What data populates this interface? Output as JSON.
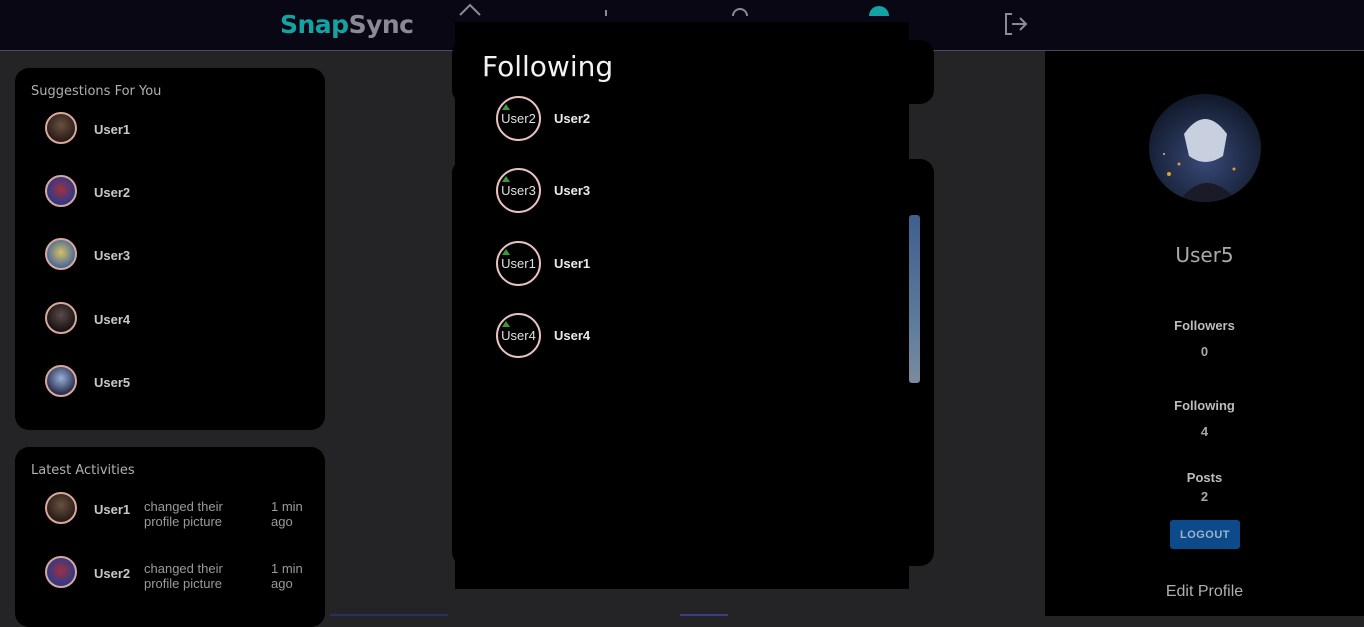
{
  "app": {
    "logo_part1": "Snap",
    "logo_part2": "Sync",
    "accent_color": "#14a3a3"
  },
  "nav": {
    "icons": [
      "home-icon",
      "add-icon",
      "search-icon",
      "profile-icon",
      "logout-icon"
    ]
  },
  "suggestions": {
    "title": "Suggestions For You",
    "users": [
      {
        "name": "User1"
      },
      {
        "name": "User2"
      },
      {
        "name": "User3"
      },
      {
        "name": "User4"
      },
      {
        "name": "User5"
      }
    ]
  },
  "activities": {
    "title": "Latest Activities",
    "items": [
      {
        "user": "User1",
        "text": "changed their profile picture",
        "time": "1 min ago"
      },
      {
        "user": "User2",
        "text": "changed their profile picture",
        "time": "1 min ago"
      }
    ]
  },
  "modal": {
    "title": "Following",
    "users": [
      {
        "name": "User2",
        "alt": "User2"
      },
      {
        "name": "User3",
        "alt": "User3"
      },
      {
        "name": "User1",
        "alt": "User1"
      },
      {
        "name": "User4",
        "alt": "User4"
      }
    ]
  },
  "profile": {
    "name": "User5",
    "followers_label": "Followers",
    "followers_value": "0",
    "following_label": "Following",
    "following_value": "4",
    "posts_label": "Posts",
    "posts_value": "2",
    "logout_label": "LOGOUT",
    "edit_label": "Edit Profile"
  }
}
